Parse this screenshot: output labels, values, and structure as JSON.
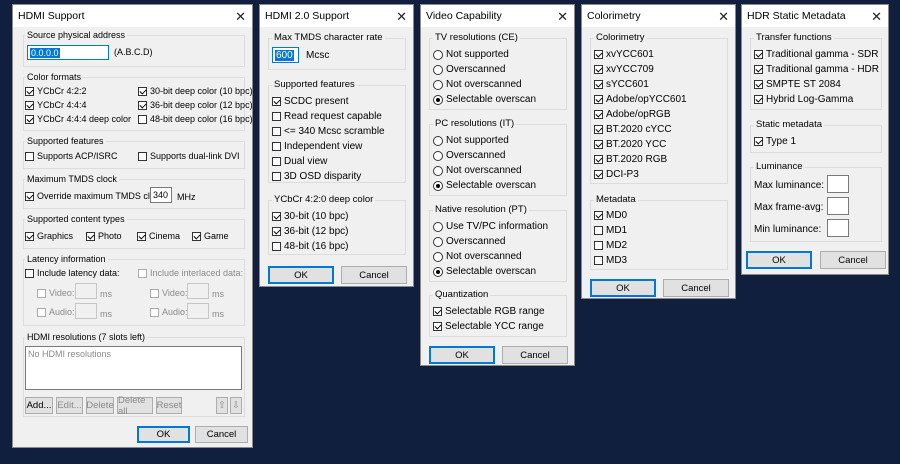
{
  "hdmi": {
    "title": "HDMI Support",
    "addr_group": "Source physical address",
    "addr_value": "0.0.0.0",
    "addr_hint": "(A.B.C.D)",
    "color_group": "Color formats",
    "color_left": [
      {
        "label": "YCbCr 4:2:2",
        "checked": true
      },
      {
        "label": "YCbCr 4:4:4",
        "checked": true
      },
      {
        "label": "YCbCr 4:4:4 deep color",
        "checked": true
      }
    ],
    "color_right": [
      {
        "label": "30-bit deep color (10 bpc)",
        "checked": true
      },
      {
        "label": "36-bit deep color (12 bpc)",
        "checked": true
      },
      {
        "label": "48-bit deep color (16 bpc)",
        "checked": false
      }
    ],
    "features_group": "Supported features",
    "feature_acp": "Supports ACP/ISRC",
    "feature_dual": "Supports dual-link DVI",
    "tmds_group": "Maximum TMDS clock",
    "tmds_override": "Override maximum TMDS clock:",
    "tmds_value": "340",
    "tmds_unit": "MHz",
    "content_group": "Supported content types",
    "content": [
      {
        "label": "Graphics",
        "checked": true
      },
      {
        "label": "Photo",
        "checked": true
      },
      {
        "label": "Cinema",
        "checked": true
      },
      {
        "label": "Game",
        "checked": true
      }
    ],
    "latency_group": "Latency information",
    "latency_include": "Include latency data:",
    "latency_interlaced": "Include interlaced data:",
    "video_label": "Video:",
    "audio_label": "Audio:",
    "ms": "ms",
    "res_group": "HDMI resolutions (7 slots left)",
    "res_empty": "No HDMI resolutions",
    "btn_add": "Add...",
    "btn_edit": "Edit...",
    "btn_delete": "Delete",
    "btn_delete_all": "Delete all",
    "btn_reset": "Reset",
    "up": "⇧",
    "down": "⇩",
    "ok": "OK",
    "cancel": "Cancel"
  },
  "hdmi20": {
    "title": "HDMI 2.0 Support",
    "rate_group": "Max TMDS character rate",
    "rate_value": "600",
    "rate_unit": "Mcsc",
    "features_group": "Supported features",
    "features": [
      {
        "label": "SCDC present",
        "checked": true
      },
      {
        "label": "Read request capable",
        "checked": false
      },
      {
        "label": "<= 340 Mcsc scramble",
        "checked": false
      },
      {
        "label": "Independent view",
        "checked": false
      },
      {
        "label": "Dual view",
        "checked": false
      },
      {
        "label": "3D OSD disparity",
        "checked": false
      }
    ],
    "deep_group": "YCbCr 4:2:0 deep color",
    "deep": [
      {
        "label": "30-bit (10 bpc)",
        "checked": true
      },
      {
        "label": "36-bit (12 bpc)",
        "checked": true
      },
      {
        "label": "48-bit (16 bpc)",
        "checked": false
      }
    ],
    "ok": "OK",
    "cancel": "Cancel"
  },
  "video": {
    "title": "Video Capability",
    "ce_group": "TV resolutions (CE)",
    "it_group": "PC resolutions (IT)",
    "pt_group": "Native resolution (PT)",
    "options": [
      "Not supported",
      "Overscanned",
      "Not overscanned",
      "Selectable overscan"
    ],
    "pt_options": [
      "Use TV/PC information",
      "Overscanned",
      "Not overscanned",
      "Selectable overscan"
    ],
    "quant_group": "Quantization",
    "quant": [
      {
        "label": "Selectable RGB range",
        "checked": true
      },
      {
        "label": "Selectable YCC range",
        "checked": true
      }
    ],
    "ok": "OK",
    "cancel": "Cancel"
  },
  "colorimetry": {
    "title": "Colorimetry",
    "group": "Colorimetry",
    "items": [
      {
        "label": "xvYCC601",
        "checked": true
      },
      {
        "label": "xvYCC709",
        "checked": true
      },
      {
        "label": "sYCC601",
        "checked": true
      },
      {
        "label": "Adobe/opYCC601",
        "checked": true
      },
      {
        "label": "Adobe/opRGB",
        "checked": true
      },
      {
        "label": "BT.2020 cYCC",
        "checked": true
      },
      {
        "label": "BT.2020 YCC",
        "checked": true
      },
      {
        "label": "BT.2020 RGB",
        "checked": true
      },
      {
        "label": "DCI-P3",
        "checked": true
      }
    ],
    "meta_group": "Metadata",
    "meta": [
      {
        "label": "MD0",
        "checked": true
      },
      {
        "label": "MD1",
        "checked": false
      },
      {
        "label": "MD2",
        "checked": false
      },
      {
        "label": "MD3",
        "checked": false
      }
    ],
    "ok": "OK",
    "cancel": "Cancel"
  },
  "hdr": {
    "title": "HDR Static Metadata",
    "tf_group": "Transfer functions",
    "tf": [
      {
        "label": "Traditional gamma - SDR",
        "checked": true
      },
      {
        "label": "Traditional gamma - HDR",
        "checked": true
      },
      {
        "label": "SMPTE ST 2084",
        "checked": true
      },
      {
        "label": "Hybrid Log-Gamma",
        "checked": true
      }
    ],
    "sm_group": "Static metadata",
    "sm": [
      {
        "label": "Type 1",
        "checked": true
      }
    ],
    "lum_group": "Luminance",
    "max_lum": "Max luminance:",
    "max_avg": "Max frame-avg:",
    "min_lum": "Min luminance:",
    "ok": "OK",
    "cancel": "Cancel"
  }
}
